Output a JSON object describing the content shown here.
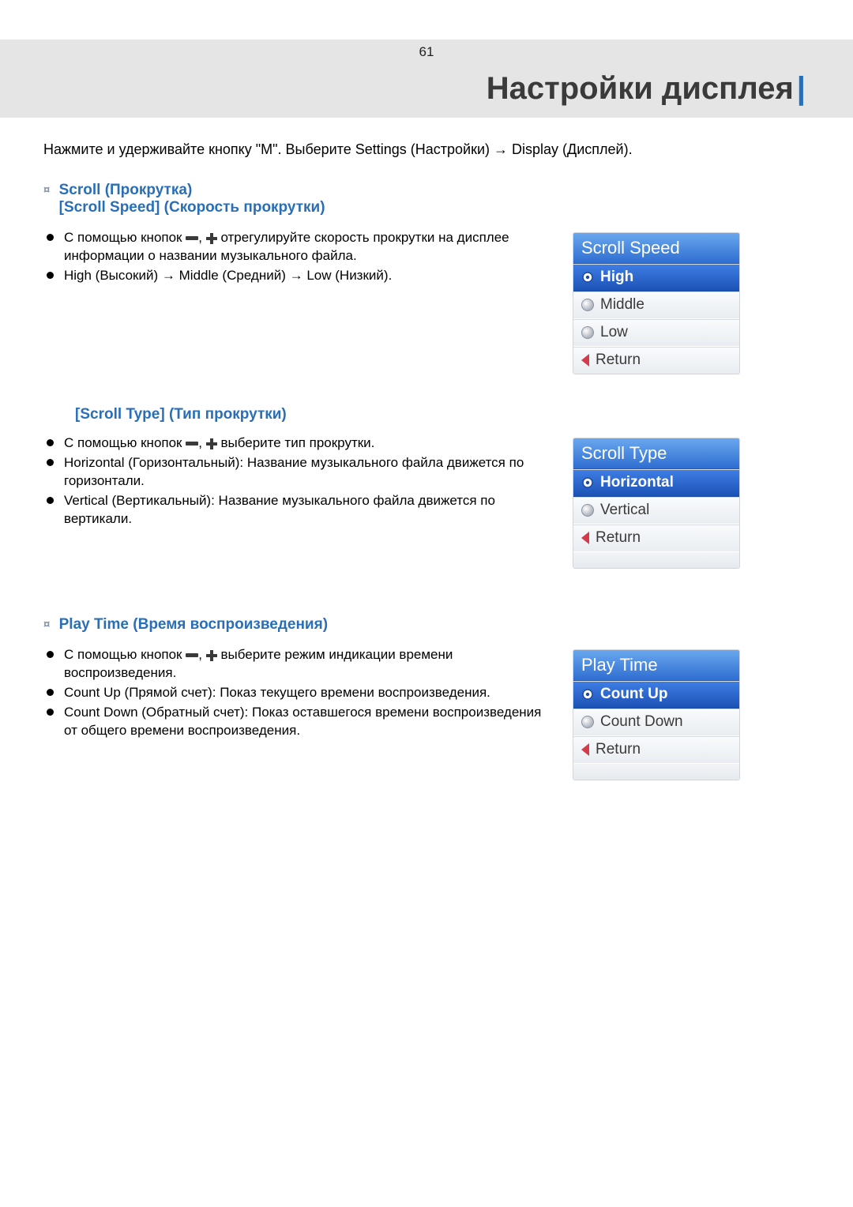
{
  "page_number": "61",
  "page_title": "Настройки дисплея",
  "intro_prefix": "Нажмите и удерживайте кнопку \"M\". Выберите Settings (Настройки)",
  "intro_suffix": "Display (Дисплей).",
  "arrow": "→",
  "sections": {
    "scroll": {
      "heading_line1": "Scroll (Прокрутка)",
      "heading_line2": "[Scroll Speed] (Скорость прокрутки)",
      "b1_pre": "С помощью кнопок",
      "b1_mid": ",",
      "b1_post": "отрегулируйте скорость прокрутки на дисплее информации о названии музыкального файла.",
      "b2_pre": "High (Высокий)",
      "b2_mid": "Middle (Средний)",
      "b2_post": "Low (Низкий).",
      "panel": {
        "title": "Scroll Speed",
        "items": [
          "High",
          "Middle",
          "Low",
          "Return"
        ],
        "selected": "High"
      }
    },
    "scroll_type": {
      "heading": "[Scroll Type] (Тип прокрутки)",
      "b1_pre": "С помощью кнопок",
      "b1_mid": ",",
      "b1_post": "выберите тип прокрутки.",
      "b2": "Horizontal (Горизонтальный): Название музыкального файла движется по горизонтали.",
      "b3": "Vertical (Вертикальный): Название музыкального файла движется по вертикали.",
      "panel": {
        "title": "Scroll Type",
        "items": [
          "Horizontal",
          "Vertical",
          "Return"
        ],
        "selected": "Horizontal"
      }
    },
    "play_time": {
      "heading": "Play Time (Время воспроизведения)",
      "b1_pre": "С помощью кнопок",
      "b1_mid": ",",
      "b1_post": "выберите режим индикации времени воспроизведения.",
      "b2": "Count Up (Прямой счет): Показ текущего времени воспроизведения.",
      "b3": "Count Down (Обратный счет): Показ оставшегося времени воспроизведения от общего времени воспроизведения.",
      "panel": {
        "title": "Play Time",
        "items": [
          "Count Up",
          "Count Down",
          "Return"
        ],
        "selected": "Count Up"
      }
    }
  }
}
